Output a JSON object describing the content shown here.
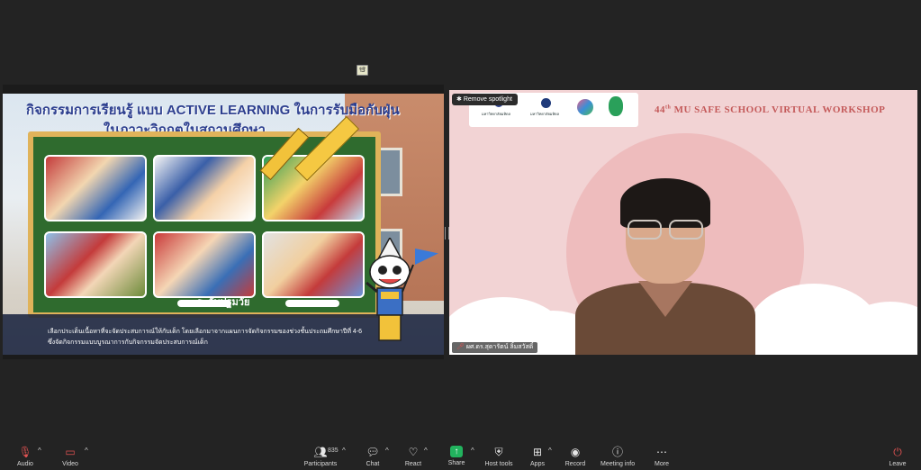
{
  "window": {
    "share_indicator": "📽"
  },
  "shared_slide": {
    "title_line1": "กิจกรรมการเรียนรู้ แบบ ACTIVE LEARNING ในการรับมือกับฝุ่น",
    "title_line2": "ในภาวะวิกฤตในสถานศึกษา",
    "board_caption": "ระดับปฐมวัย",
    "footer_line1": "เลือกประเด็นเนื้อหาที่จะจัดประสบการณ์ให้กับเด็ก โดยเลือกมาจากแผนการจัดกิจกรรมของช่วงชั้นประถมศึกษาปีที่ 4-6",
    "footer_line2": "ซึ่งจัดกิจกรรมแบบบูรณาการกับกิจกรรมจัดประสบการณ์เด็ก"
  },
  "speaker": {
    "spotlight_button": "Remove spotlight",
    "workshop_title_prefix": "44",
    "workshop_title_sup": "th",
    "workshop_title": " MU SAFE SCHOOL VIRTUAL WORKSHOP",
    "logo1_text": "มหาวิทยาลัยมหิดล",
    "logo2_text": "มหาวิทยาลัยมหิดล",
    "name_tag": "ผศ.ดร.สุดารัตน์ ลิ้มสวัสดิ์"
  },
  "toolbar": {
    "audio": "Audio",
    "video": "Video",
    "participants": "Participants",
    "participants_count": "835",
    "chat": "Chat",
    "react": "React",
    "share": "Share",
    "host_tools": "Host tools",
    "apps": "Apps",
    "record": "Record",
    "meeting_info": "Meeting info",
    "more": "More",
    "leave": "Leave"
  },
  "colors": {
    "share_green": "#22b35e",
    "muted_red": "#e05252",
    "background": "#232323"
  }
}
